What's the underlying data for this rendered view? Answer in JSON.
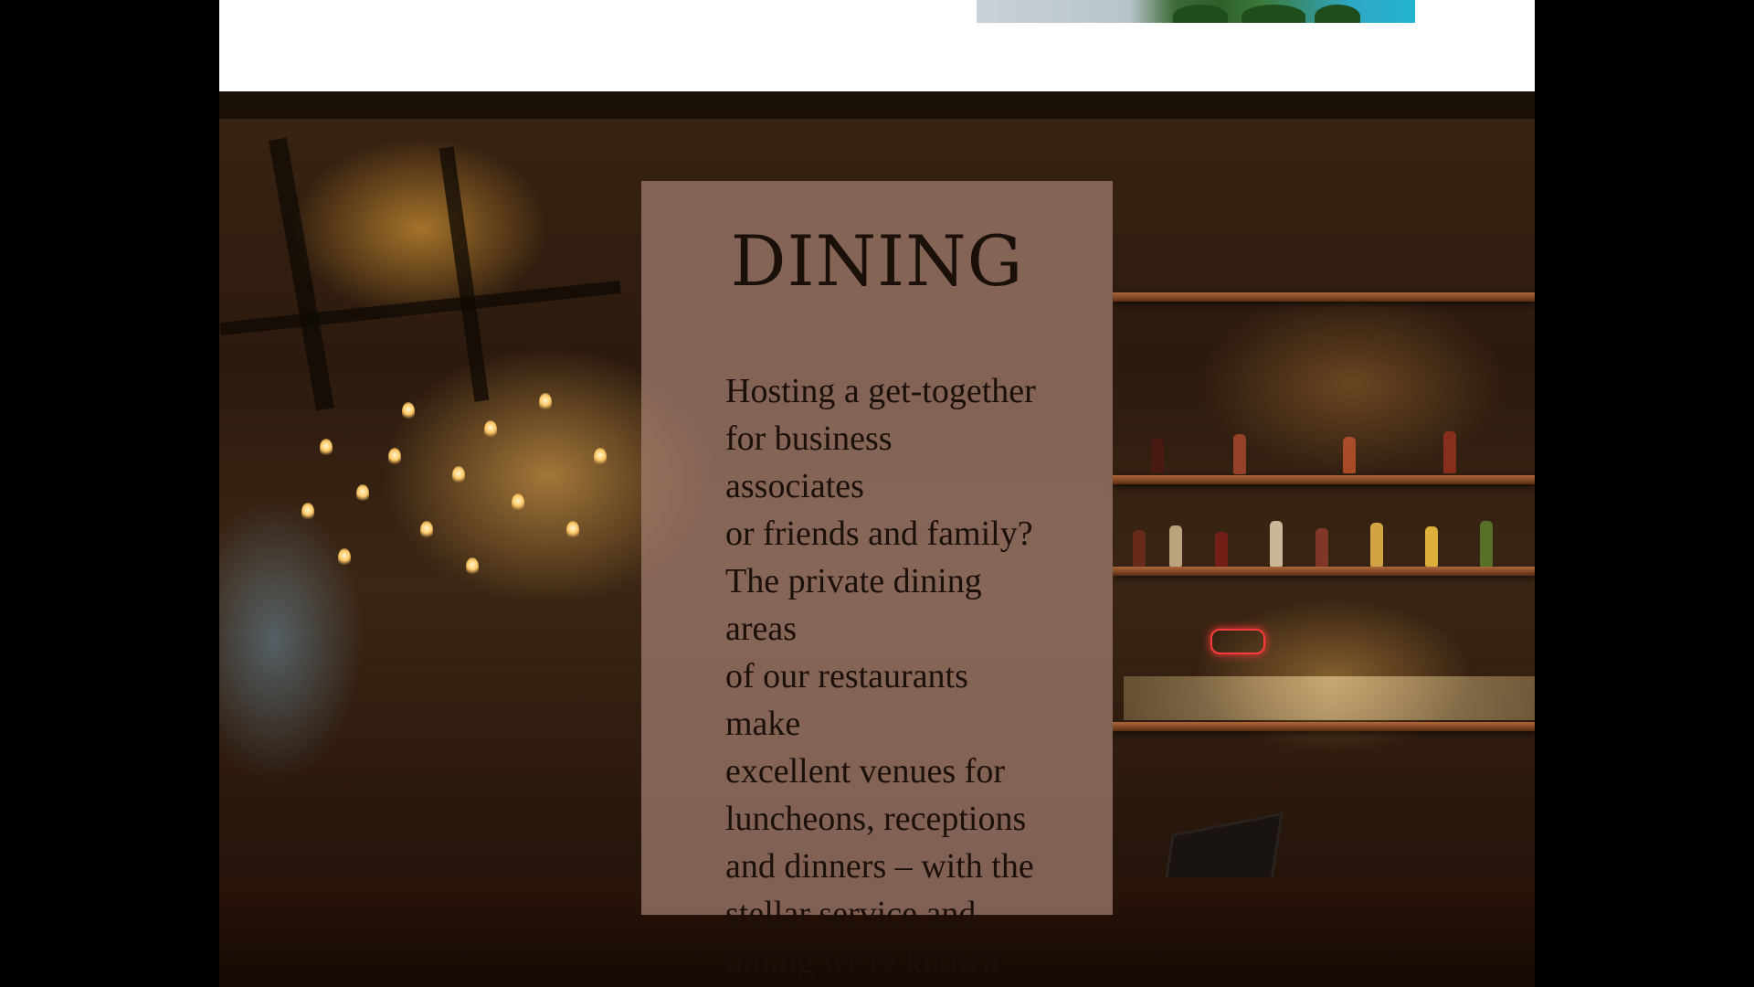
{
  "dining": {
    "title": "DINING",
    "lines": [
      "Hosting a get-together",
      "for business associates",
      "or friends and family?",
      "The private dining areas",
      "of our restaurants make",
      "excellent venues for",
      "luncheons, receptions",
      "and dinners – with the",
      "stellar service and",
      "dining we're known for."
    ],
    "background_image": "restaurant-bar-interior"
  },
  "top_section": {
    "image": "tropical-palm-trees"
  },
  "scroll_to_top": {
    "icon": "chevron-up-icon"
  },
  "colors": {
    "page_background": "#000000",
    "content_background": "#ffffff",
    "panel_overlay": "#a48070",
    "text": "#1b0f0a",
    "scroll_button": "#bebebe"
  }
}
